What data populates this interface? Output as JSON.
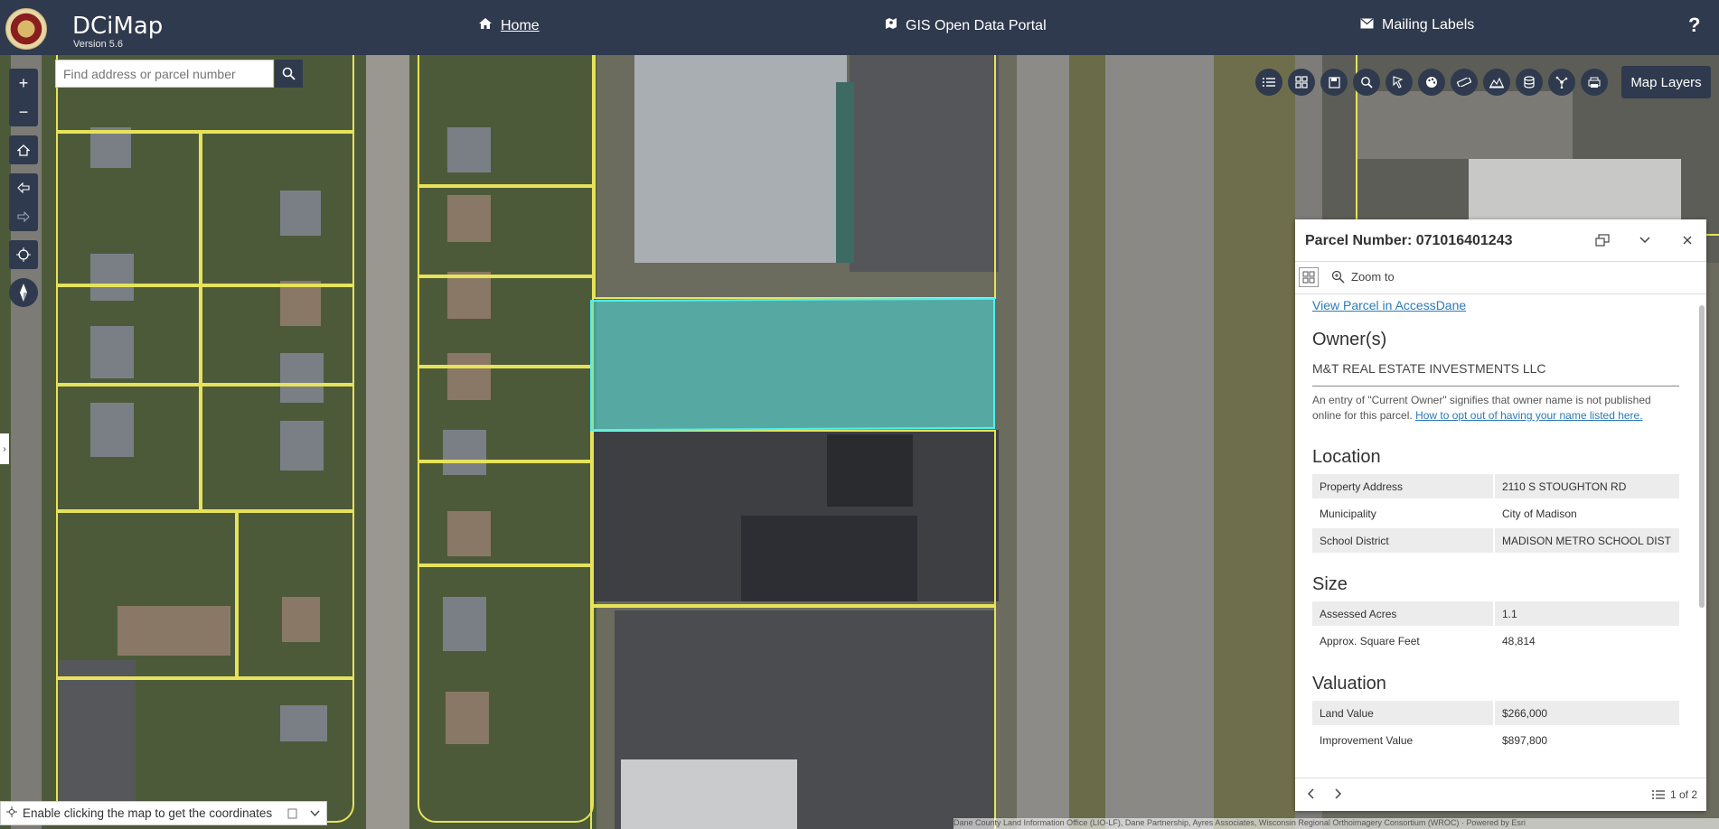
{
  "header": {
    "app_title": "DCiMap",
    "version": "Version 5.6",
    "nav": {
      "home": "Home",
      "gis_portal": "GIS Open Data Portal",
      "mailing_labels": "Mailing Labels"
    },
    "help": "?"
  },
  "search": {
    "placeholder": "Find address or parcel number"
  },
  "map_layers_label": "Map Layers",
  "toolbar_icons": [
    "list-icon",
    "basemap-icon",
    "save-icon",
    "search-icon",
    "identify-icon",
    "palette-icon",
    "measure-icon",
    "elevation-icon",
    "database-icon",
    "network-icon",
    "print-icon"
  ],
  "popup": {
    "title": "Parcel Number: 071016401243",
    "zoom_to": "Zoom to",
    "view_link": "View Parcel in AccessDane",
    "owners_heading": "Owner(s)",
    "owner_name": "M&T REAL ESTATE INVESTMENTS LLC",
    "note_text": "An entry of \"Current Owner\" signifies that owner name is not published online for this parcel.",
    "note_link": "How to opt out of having your name listed here.",
    "location_heading": "Location",
    "location": [
      {
        "label": "Property Address",
        "value": "2110 S STOUGHTON RD"
      },
      {
        "label": "Municipality",
        "value": "City of Madison"
      },
      {
        "label": "School District",
        "value": "MADISON METRO SCHOOL DIST"
      }
    ],
    "size_heading": "Size",
    "size": [
      {
        "label": "Assessed Acres",
        "value": "1.1"
      },
      {
        "label": "Approx. Square Feet",
        "value": "48,814"
      }
    ],
    "valuation_heading": "Valuation",
    "valuation": [
      {
        "label": "Land Value",
        "value": "$266,000"
      },
      {
        "label": "Improvement Value",
        "value": "$897,800"
      }
    ],
    "pagination": "1 of 2"
  },
  "coordinates_toggle": "Enable clicking the map to get the coordinates",
  "attribution": "Dane County Land Information Office (LIO-LF), Dane Partnership, Ayres Associates, Wisconsin Regional Orthoimagery Consortium (WROC) · Powered by Esri",
  "colors": {
    "header_bg": "#2f3a4e",
    "selected_parcel": "#4ff0f0",
    "parcel_lines": "#e6e35a",
    "link": "#2b7bb9"
  }
}
